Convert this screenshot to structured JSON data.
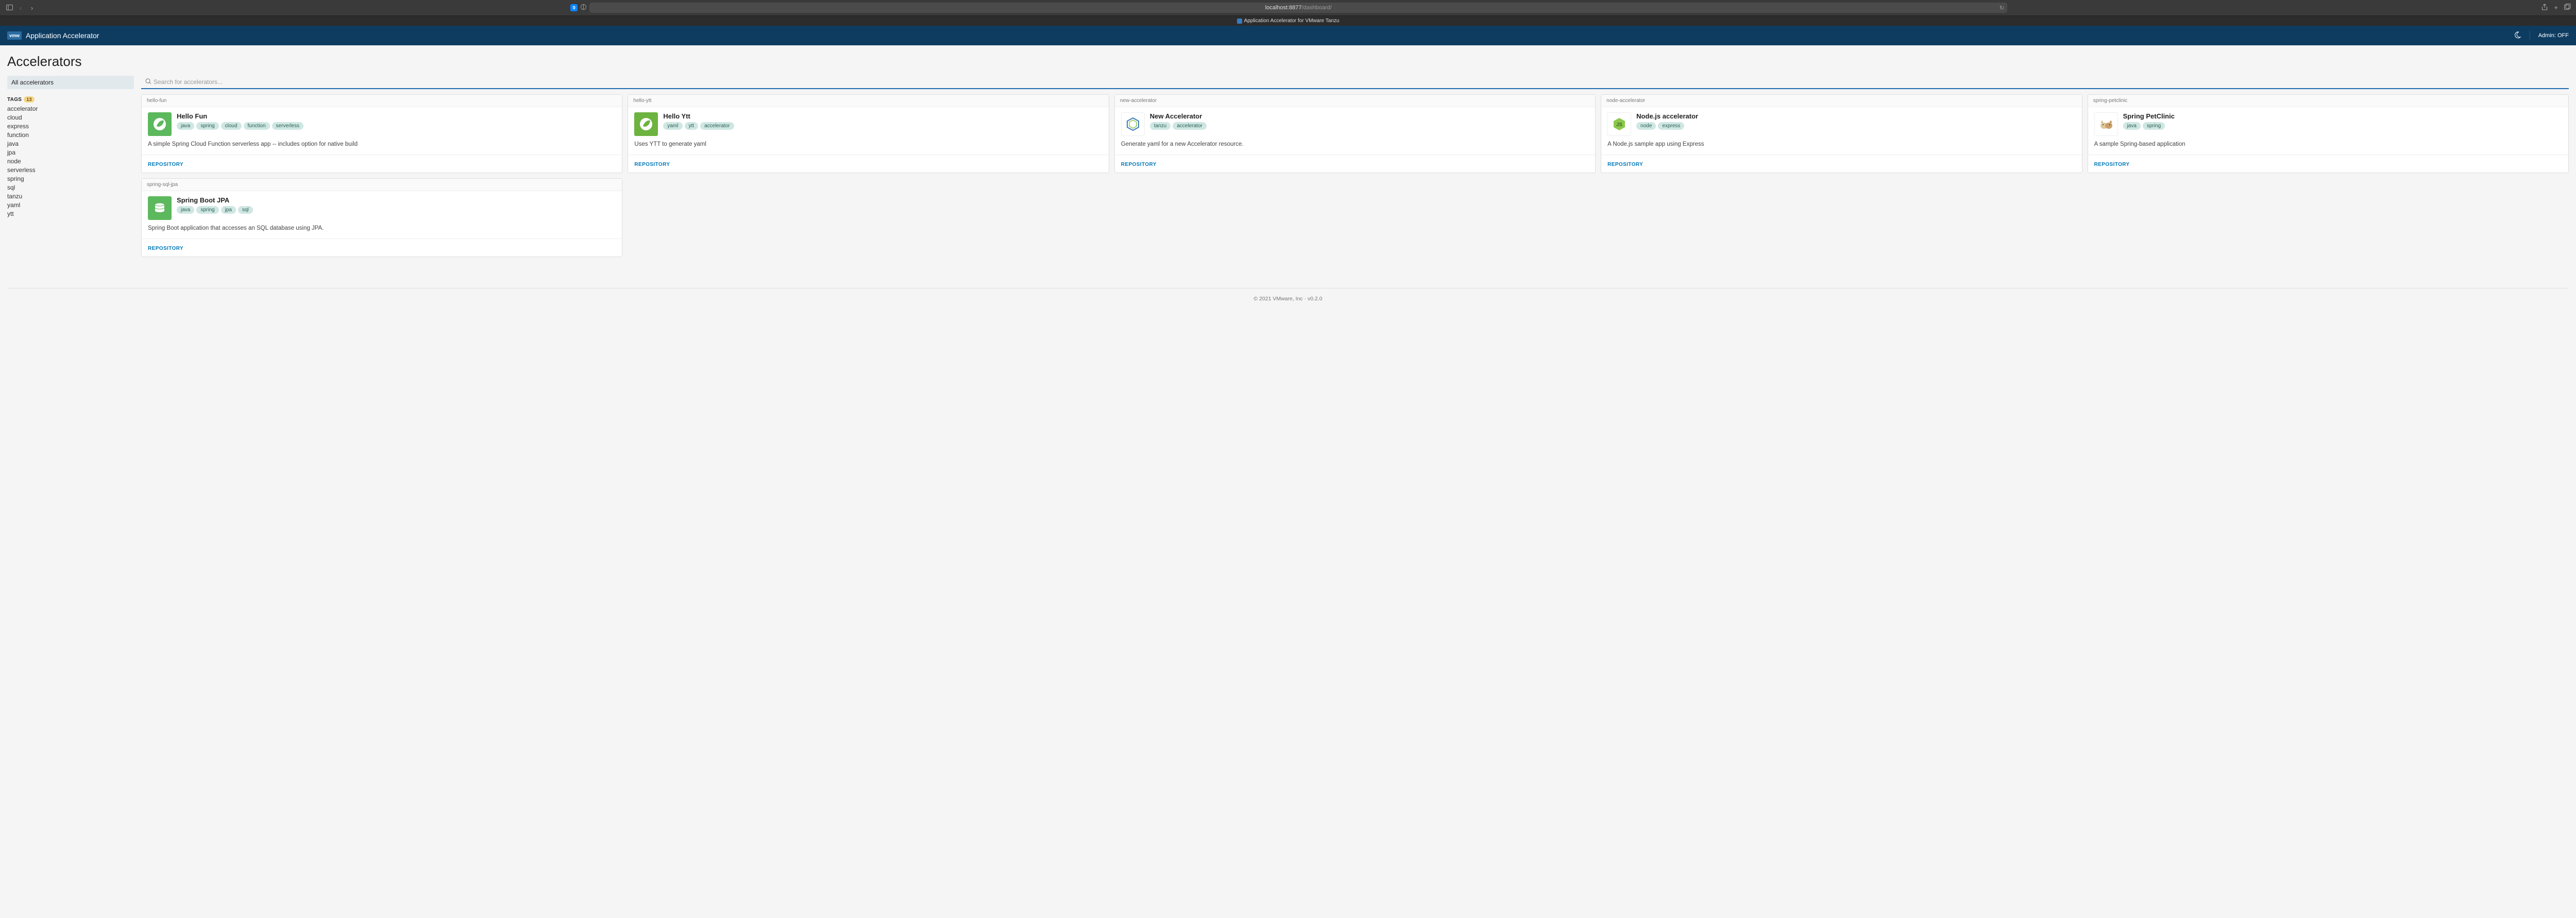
{
  "browser": {
    "url_host": "localhost:8877",
    "url_path": "/dashboard/",
    "shield_badge": "0",
    "tab_title": "Application Accelerator for VMware Tanzu"
  },
  "header": {
    "logo_text": "vmw",
    "app_title": "Application Accelerator",
    "admin_label": "Admin: OFF"
  },
  "page": {
    "title": "Accelerators"
  },
  "sidebar": {
    "all_label": "All accelerators",
    "tags_label": "TAGS",
    "tags_count": "13",
    "tags": [
      "accelerator",
      "cloud",
      "express",
      "function",
      "java",
      "jpa",
      "node",
      "serverless",
      "spring",
      "sql",
      "tanzu",
      "yaml",
      "ytt"
    ]
  },
  "search": {
    "placeholder": "Search for accelerators..."
  },
  "repo_label": "REPOSITORY",
  "cards": [
    {
      "slug": "hello-fun",
      "title": "Hello Fun",
      "tags": [
        "java",
        "spring",
        "cloud",
        "function",
        "serverless"
      ],
      "desc": "A simple Spring Cloud Function serverless app -- includes option for native build",
      "icon": "leaf-green"
    },
    {
      "slug": "hello-ytt",
      "title": "Hello Ytt",
      "tags": [
        "yaml",
        "ytt",
        "accelerator"
      ],
      "desc": "Uses YTT to generate yaml",
      "icon": "spring"
    },
    {
      "slug": "new-accelerator",
      "title": "New Accelerator",
      "tags": [
        "tanzu",
        "accelerator"
      ],
      "desc": "Generate yaml for a new Accelerator resource.",
      "icon": "hexagon"
    },
    {
      "slug": "node-accelerator",
      "title": "Node.js accelerator",
      "tags": [
        "node",
        "express"
      ],
      "desc": "A Node.js sample app using Express",
      "icon": "node"
    },
    {
      "slug": "spring-petclinic",
      "title": "Spring PetClinic",
      "tags": [
        "java",
        "spring"
      ],
      "desc": "A sample Spring-based application",
      "icon": "pets"
    },
    {
      "slug": "spring-sql-jpa",
      "title": "Spring Boot JPA",
      "tags": [
        "java",
        "spring",
        "jpa",
        "sql"
      ],
      "desc": "Spring Boot application that accesses an SQL database using JPA.",
      "icon": "db-green"
    }
  ],
  "footer": {
    "text": "© 2021 VMware, Inc · v0.2.0"
  },
  "icons": {
    "sidebar": "sidebar-icon",
    "back": "chevron-left-icon",
    "forward": "chevron-right-icon",
    "share": "share-icon",
    "new_tab": "plus-icon",
    "tabs": "tabs-icon",
    "moon": "moon-icon",
    "search": "search-icon",
    "reload": "reload-icon",
    "reader": "reader-icon"
  }
}
